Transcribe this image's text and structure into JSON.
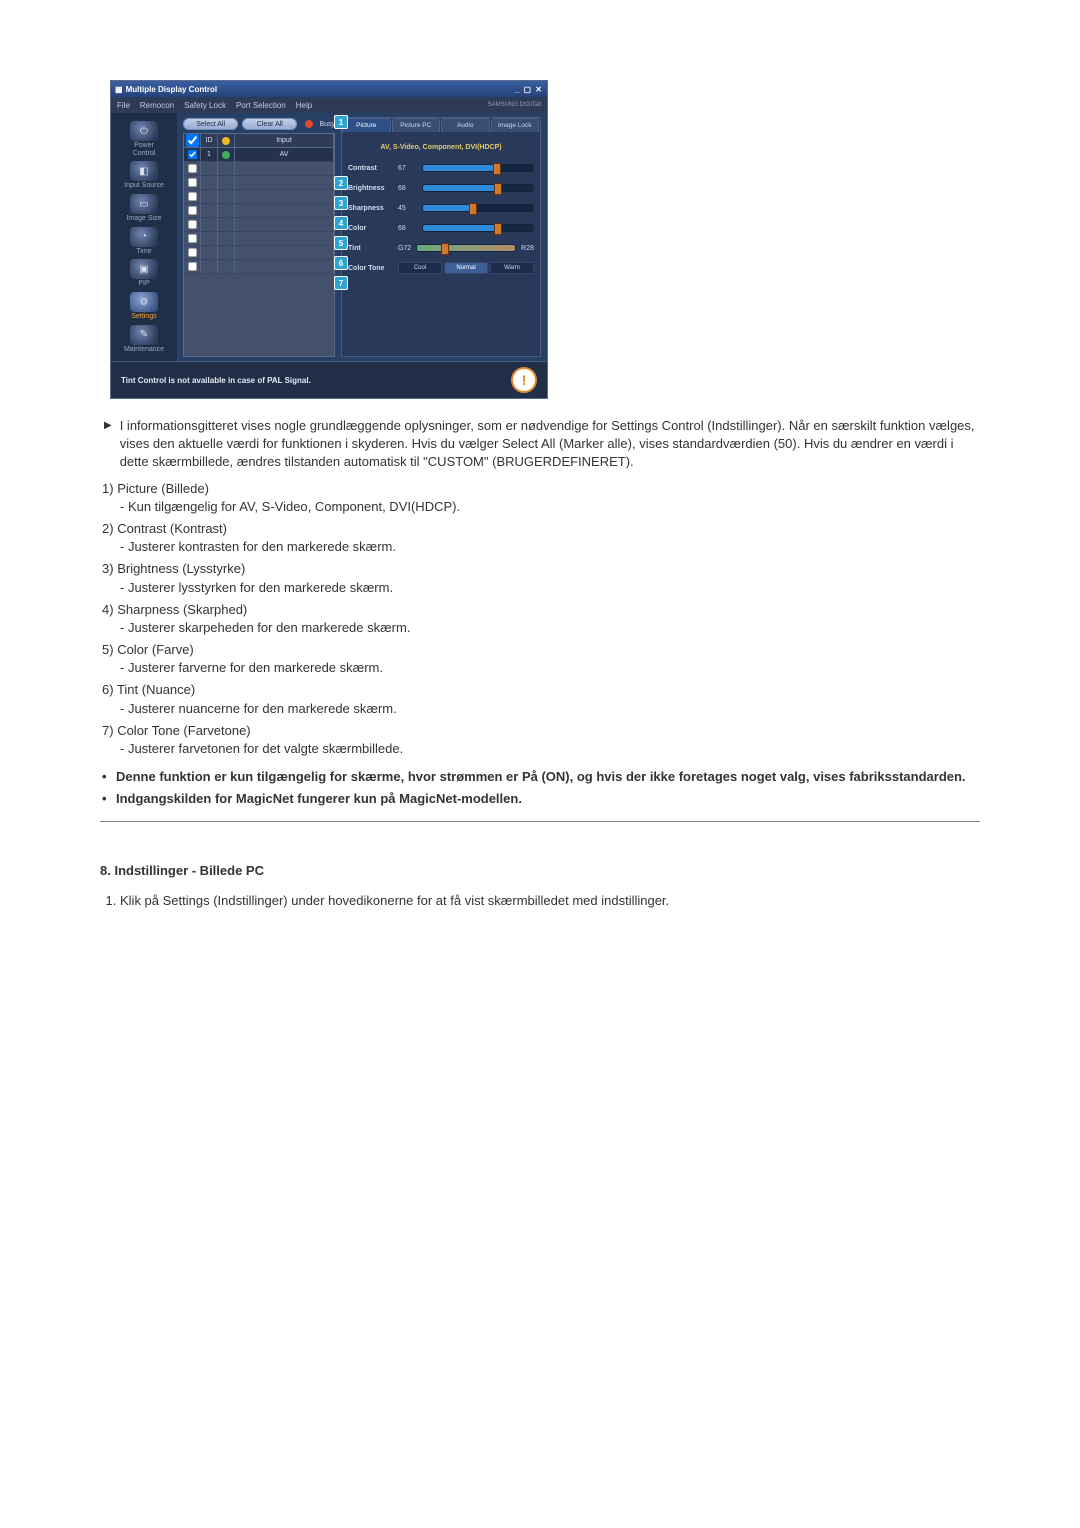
{
  "screenshot": {
    "title": "Multiple Display Control",
    "menus": [
      "File",
      "Remocon",
      "Safety Lock",
      "Port Selection",
      "Help"
    ],
    "brand": "SAMSUNG DIGITall",
    "sidebar": [
      {
        "label": "Power Control"
      },
      {
        "label": "Input Source"
      },
      {
        "label": "Image Size"
      },
      {
        "label": "Time"
      },
      {
        "label": "PIP"
      },
      {
        "label": "Settings"
      },
      {
        "label": "Maintenance"
      }
    ],
    "buttons": {
      "select_all": "Select All",
      "clear_all": "Clear All",
      "busy": "Busy"
    },
    "grid": {
      "head": {
        "chk": "",
        "id": "ID",
        "ic": "",
        "input": "Input"
      },
      "rows": [
        {
          "sel": true,
          "id": "1",
          "input": "AV"
        },
        {
          "sel": false
        },
        {
          "sel": false
        },
        {
          "sel": false
        },
        {
          "sel": false
        },
        {
          "sel": false
        },
        {
          "sel": false
        },
        {
          "sel": false
        },
        {
          "sel": false
        }
      ]
    },
    "tabs": [
      "Picture",
      "Picture PC",
      "Audio",
      "Image Lock"
    ],
    "active_tab": 0,
    "source_label": "AV, S-Video, Component, DVI(HDCP)",
    "controls": [
      {
        "label": "Contrast",
        "value": "67",
        "pct": 67
      },
      {
        "label": "Brightness",
        "value": "68",
        "pct": 68
      },
      {
        "label": "Sharpness",
        "value": "45",
        "pct": 45
      },
      {
        "label": "Color",
        "value": "68",
        "pct": 68
      }
    ],
    "tint": {
      "label": "Tint",
      "left": "G72",
      "right": "R28",
      "pct": 28
    },
    "tone": {
      "label": "Color Tone",
      "options": [
        "Cool",
        "Normal",
        "Warm"
      ],
      "selected": 1
    },
    "badges": {
      "b1": "1",
      "b2": "2",
      "b3": "3",
      "b4": "4",
      "b5": "5",
      "b6": "6",
      "b7": "7"
    },
    "footer_msg": "Tint Control is not available in case of PAL Signal."
  },
  "doc": {
    "intro": "I informationsgitteret vises nogle grundlæggende oplysninger, som er nødvendige for Settings Control (Indstillinger). Når en særskilt funktion vælges, vises den aktuelle værdi for funktionen i skyderen. Hvis du vælger Select All (Marker alle), vises standardværdien (50). Hvis du ændrer en værdi i dette skærmbillede, ændres tilstanden automatisk til \"CUSTOM\" (BRUGERDEFINERET).",
    "items": [
      {
        "n": "1)",
        "title": "Picture (Billede)",
        "desc": "- Kun tilgængelig for AV, S-Video, Component, DVI(HDCP)."
      },
      {
        "n": "2)",
        "title": "Contrast (Kontrast)",
        "desc": "- Justerer kontrasten for den markerede skærm."
      },
      {
        "n": "3)",
        "title": "Brightness (Lysstyrke)",
        "desc": "- Justerer lysstyrken for den markerede skærm."
      },
      {
        "n": "4)",
        "title": "Sharpness (Skarphed)",
        "desc": "- Justerer skarpeheden for den markerede skærm."
      },
      {
        "n": "5)",
        "title": "Color (Farve)",
        "desc": "- Justerer farverne for den markerede skærm."
      },
      {
        "n": "6)",
        "title": "Tint (Nuance)",
        "desc": "- Justerer nuancerne for den markerede skærm."
      },
      {
        "n": "7)",
        "title": "Color Tone (Farvetone)",
        "desc": "- Justerer farvetonen for det valgte skærmbillede."
      }
    ],
    "bullets": [
      "Denne funktion er kun tilgængelig for skærme, hvor strømmen er På (ON), og hvis der ikke foretages noget valg, vises fabriksstandarden.",
      "Indgangskilden for MagicNet fungerer kun på MagicNet-modellen."
    ],
    "section_title": "8. Indstillinger - Billede PC",
    "section_step": "Klik på Settings (Indstillinger) under hovedikonerne for at få vist skærmbilledet med indstillinger."
  }
}
